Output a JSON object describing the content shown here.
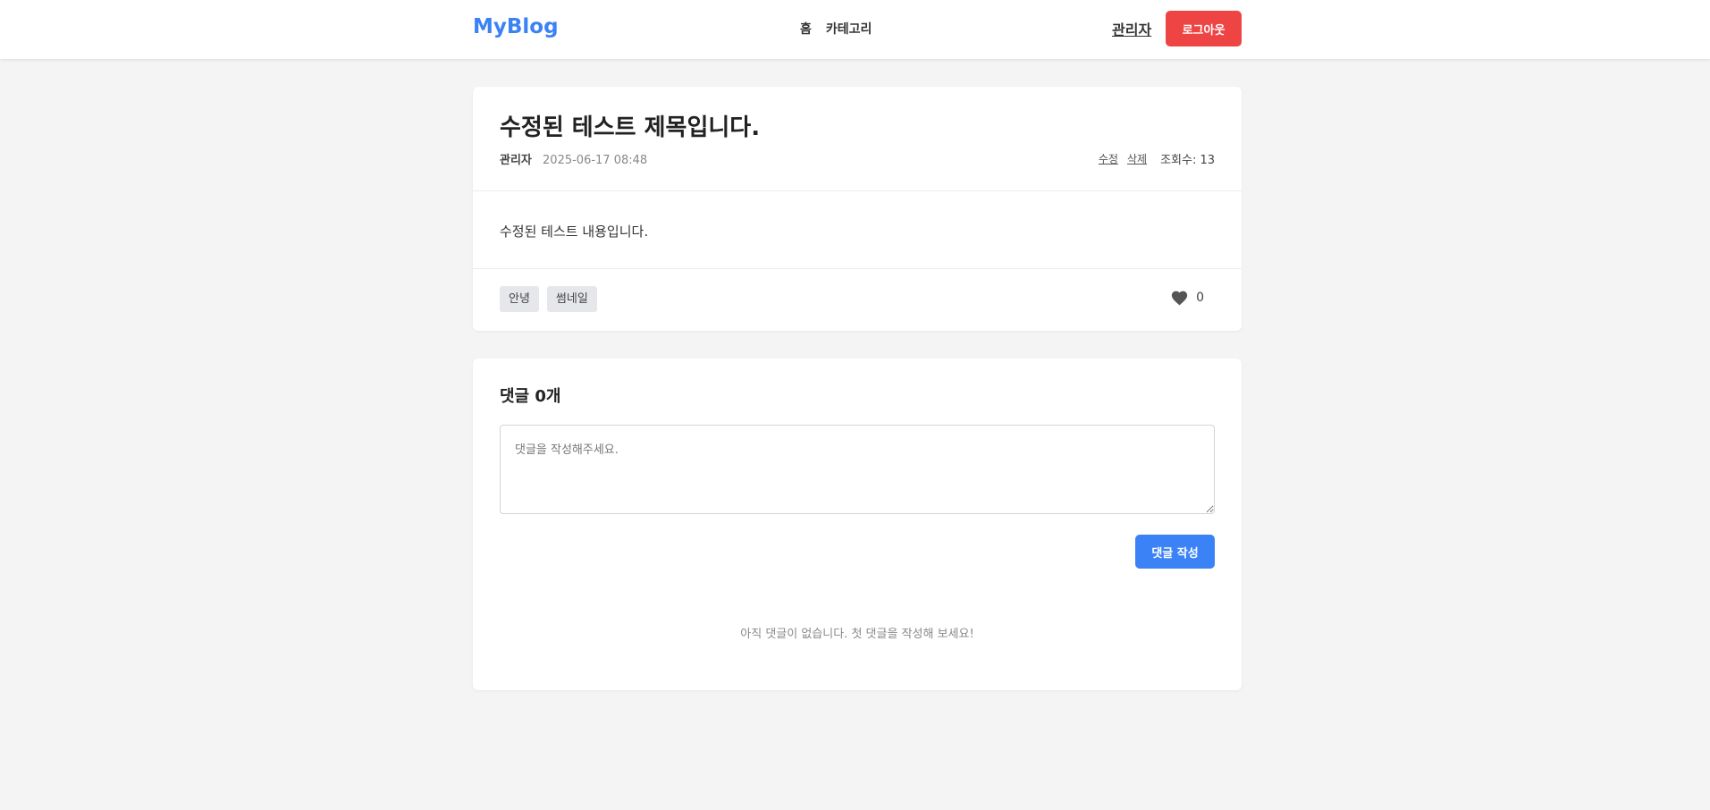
{
  "header": {
    "logo": "MyBlog",
    "nav": [
      "홈",
      "카테고리"
    ],
    "user_name": "관리자",
    "logout_label": "로그아웃",
    "logo_color": "#3b82f6",
    "logout_color": "#ef4444"
  },
  "post": {
    "title": "수정된 테스트 제목입니다.",
    "author": "관리자",
    "date": "2025-06-17 08:48",
    "edit_label": "수정",
    "delete_label": "삭제",
    "views_label": "조회수: 13",
    "content": "수정된 테스트 내용입니다.",
    "tags": [
      "안녕",
      "썸네일"
    ],
    "like_icon": "heart-icon",
    "like_count": "0"
  },
  "comments": {
    "title": "댓글 0개",
    "placeholder": "댓글을 작성해주세요.",
    "value": "",
    "submit_label": "댓글 작성",
    "submit_color": "#3b82f6",
    "empty_message": "아직 댓글이 없습니다. 첫 댓글을 작성해 보세요!"
  }
}
